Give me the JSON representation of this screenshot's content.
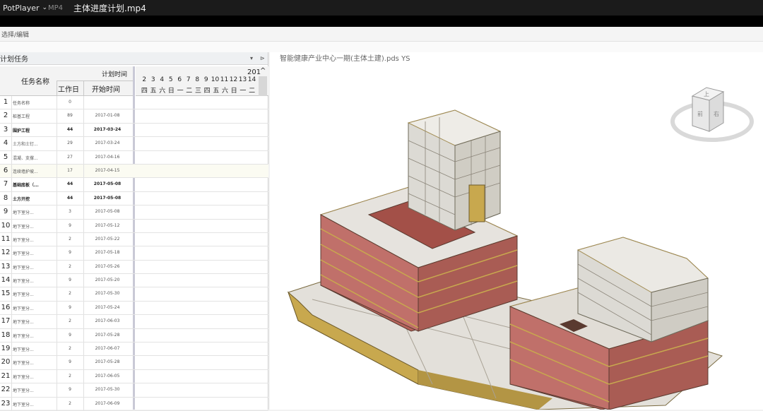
{
  "titlebar": {
    "app": "PotPlayer",
    "chevron": "⌄",
    "format": "MP4",
    "filename": "主体进度计划.mp4"
  },
  "toolbar": {
    "label": "选择/编辑"
  },
  "panel": {
    "title": "计划任务",
    "pin": "▾",
    "close": "⊳"
  },
  "grid_header": {
    "col_name": "任务名称",
    "group": "计划时间",
    "col_duration": "工作日",
    "col_start": "开始时间"
  },
  "gantt_header": {
    "year": "201",
    "days": [
      "2",
      "3",
      "4",
      "5",
      "6",
      "7",
      "8",
      "9",
      "10",
      "11",
      "12",
      "13",
      "14"
    ],
    "weekdays": [
      "四",
      "五",
      "六",
      "日",
      "一",
      "二",
      "三",
      "四",
      "五",
      "六",
      "日",
      "一",
      "二"
    ]
  },
  "rows": [
    {
      "num": "1",
      "name": "任务名称",
      "dur": "0",
      "start": "",
      "bold": false
    },
    {
      "num": "2",
      "name": "桩基工程",
      "dur": "89",
      "start": "2017-01-08",
      "bold": false
    },
    {
      "num": "3",
      "name": "围护工程",
      "dur": "44",
      "start": "2017-03-24",
      "bold": true
    },
    {
      "num": "4",
      "name": "土方和土钉...",
      "dur": "29",
      "start": "2017-03-24",
      "bold": false
    },
    {
      "num": "5",
      "name": "混凝、支撑...",
      "dur": "27",
      "start": "2017-04-16",
      "bold": false
    },
    {
      "num": "6",
      "name": "连续墙护坡...",
      "dur": "17",
      "start": "2017-04-15",
      "bold": false
    },
    {
      "num": "7",
      "name": "基础底板（...",
      "dur": "44",
      "start": "2017-05-08",
      "bold": true
    },
    {
      "num": "8",
      "name": "土方开挖",
      "dur": "44",
      "start": "2017-05-08",
      "bold": true
    },
    {
      "num": "9",
      "name": "地下室分...",
      "dur": "3",
      "start": "2017-05-08",
      "bold": false
    },
    {
      "num": "10",
      "name": "地下室分...",
      "dur": "9",
      "start": "2017-05-12",
      "bold": false
    },
    {
      "num": "11",
      "name": "地下室分...",
      "dur": "2",
      "start": "2017-05-22",
      "bold": false
    },
    {
      "num": "12",
      "name": "地下室分...",
      "dur": "9",
      "start": "2017-05-18",
      "bold": false
    },
    {
      "num": "13",
      "name": "地下室分...",
      "dur": "2",
      "start": "2017-05-26",
      "bold": false
    },
    {
      "num": "14",
      "name": "地下室分...",
      "dur": "9",
      "start": "2017-05-20",
      "bold": false
    },
    {
      "num": "15",
      "name": "地下室分...",
      "dur": "2",
      "start": "2017-05-30",
      "bold": false
    },
    {
      "num": "16",
      "name": "地下室分...",
      "dur": "9",
      "start": "2017-05-24",
      "bold": false
    },
    {
      "num": "17",
      "name": "地下室分...",
      "dur": "2",
      "start": "2017-06-03",
      "bold": false
    },
    {
      "num": "18",
      "name": "地下室分...",
      "dur": "9",
      "start": "2017-05-28",
      "bold": false
    },
    {
      "num": "19",
      "name": "地下室分...",
      "dur": "2",
      "start": "2017-06-07",
      "bold": false
    },
    {
      "num": "20",
      "name": "地下室分...",
      "dur": "9",
      "start": "2017-05-28",
      "bold": false
    },
    {
      "num": "21",
      "name": "地下室分...",
      "dur": "2",
      "start": "2017-06-05",
      "bold": false
    },
    {
      "num": "22",
      "name": "地下室分...",
      "dur": "9",
      "start": "2017-05-30",
      "bold": false
    },
    {
      "num": "23",
      "name": "地下室分...",
      "dur": "2",
      "start": "2017-06-09",
      "bold": false
    }
  ],
  "view": {
    "title": "智能健康产业中心一期(主体土建).pds YS",
    "cube_top": "上",
    "cube_front": "前",
    "cube_right": "右"
  },
  "colors": {
    "titlebar": "#1b1b1b",
    "building_brick": "#b5625a",
    "building_gold": "#c8a84e",
    "slab": "#e6e3de"
  }
}
